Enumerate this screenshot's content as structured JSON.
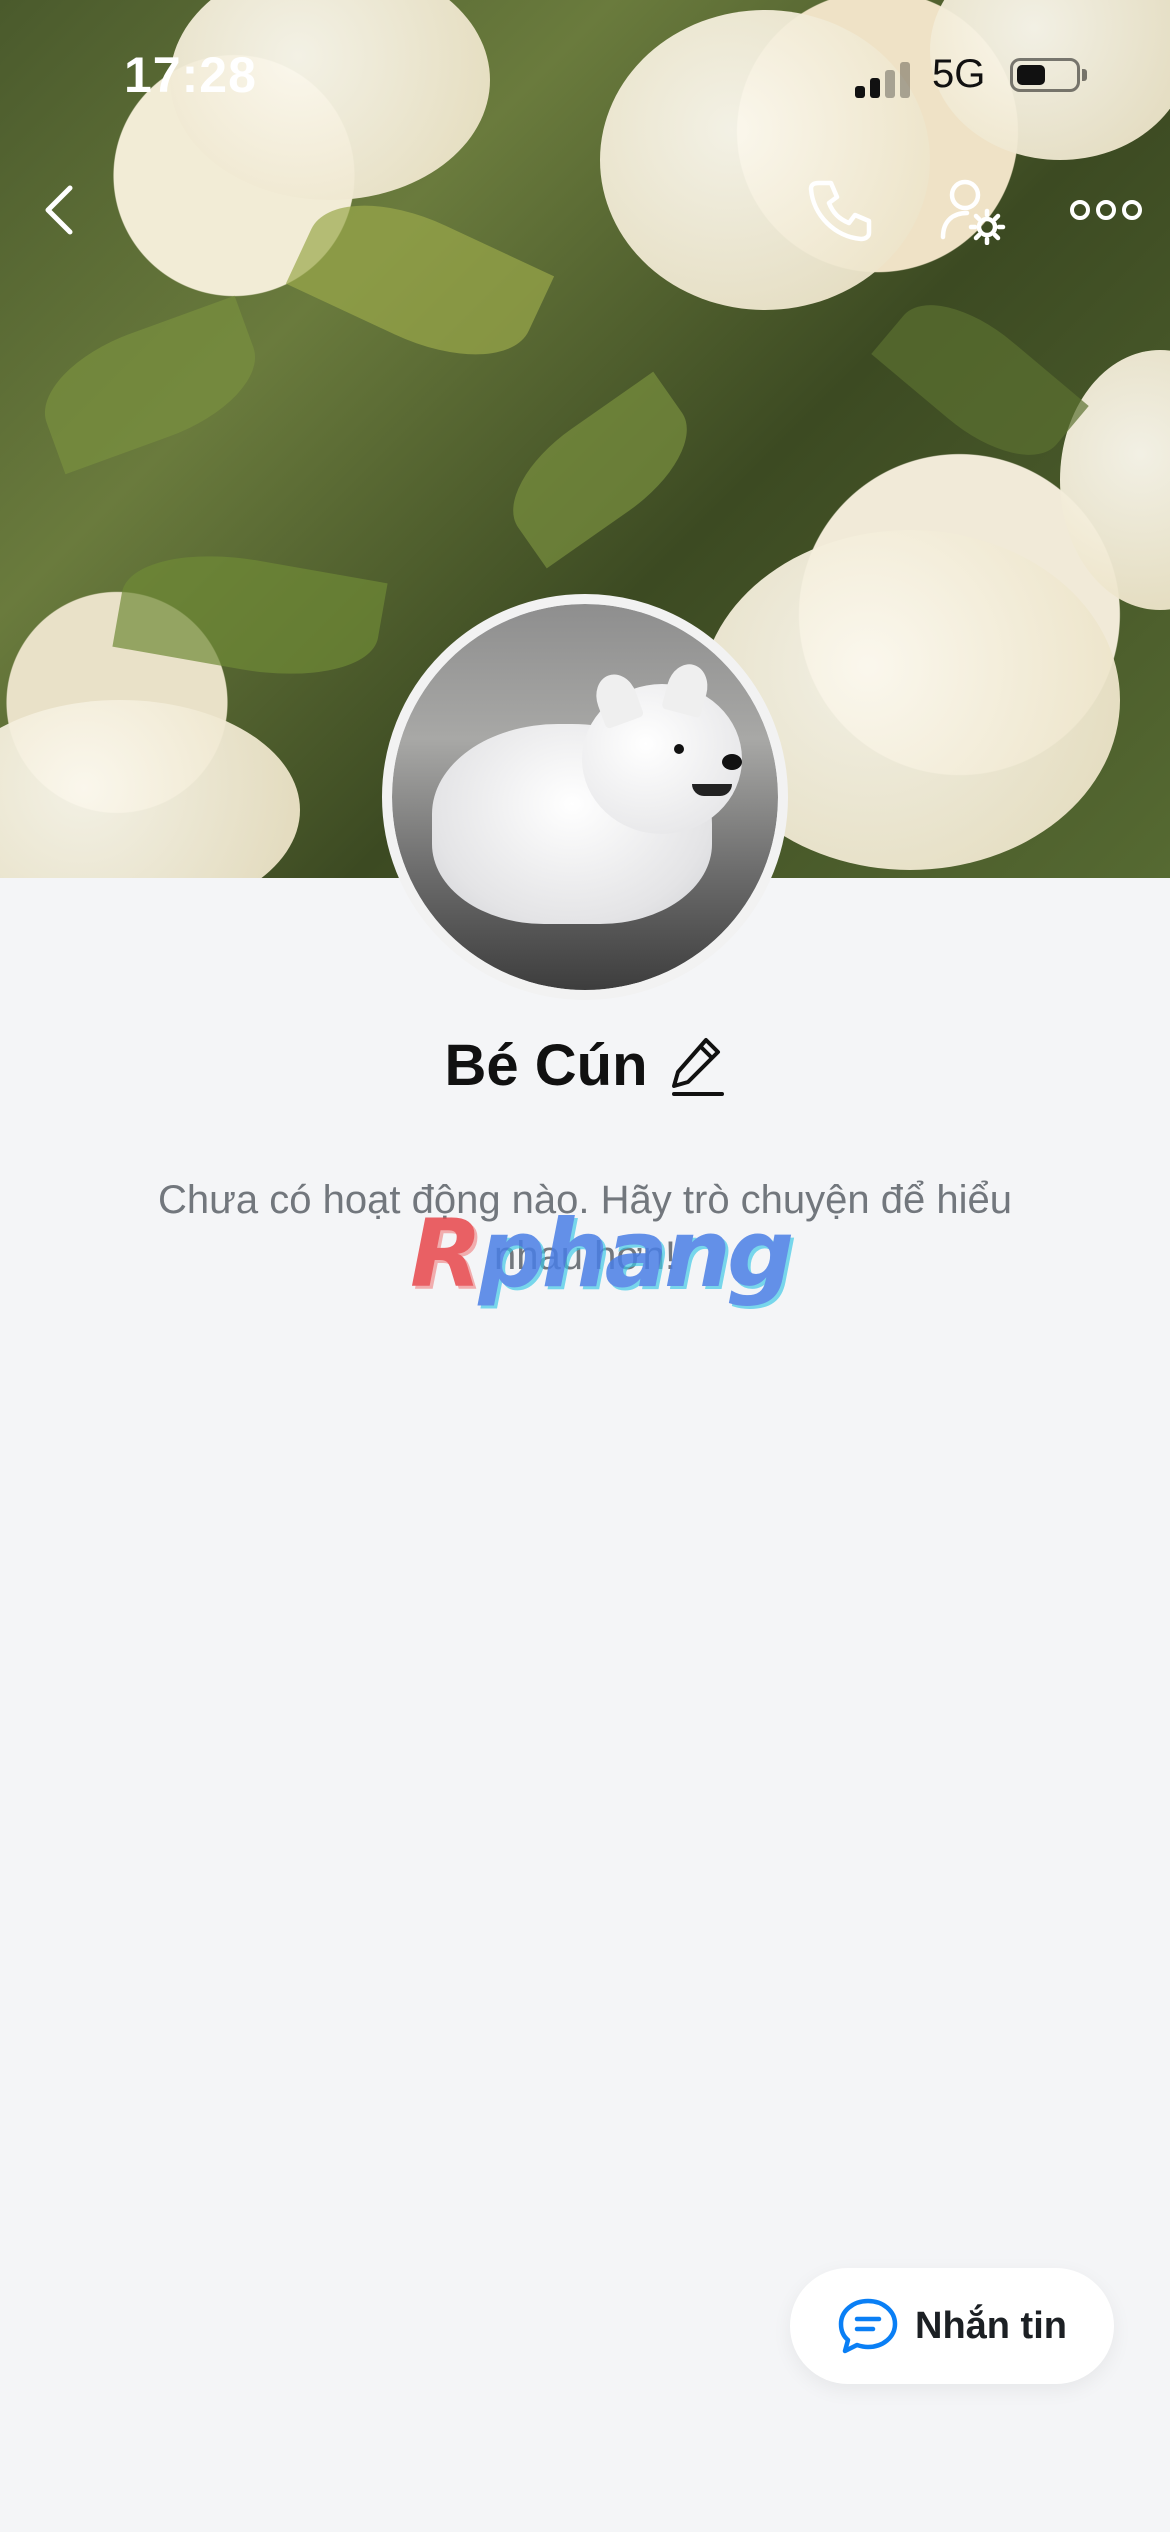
{
  "status_bar": {
    "time": "17:28",
    "network": "5G"
  },
  "nav": {
    "back_icon": "chevron-left-icon",
    "call_icon": "phone-icon",
    "settings_icon": "user-settings-icon",
    "more_icon": "more-dots-icon"
  },
  "profile": {
    "name": "Bé Cún",
    "edit_icon": "pencil-icon"
  },
  "empty_state": {
    "message": "Chưa có hoạt động nào. Hãy trò chuyện để hiểu nhau hơn!"
  },
  "watermark": {
    "first_letter": "R",
    "rest": "phang"
  },
  "message_button": {
    "label": "Nhắn tin",
    "icon": "chat-bubble-icon",
    "accent": "#0a7ff5"
  }
}
